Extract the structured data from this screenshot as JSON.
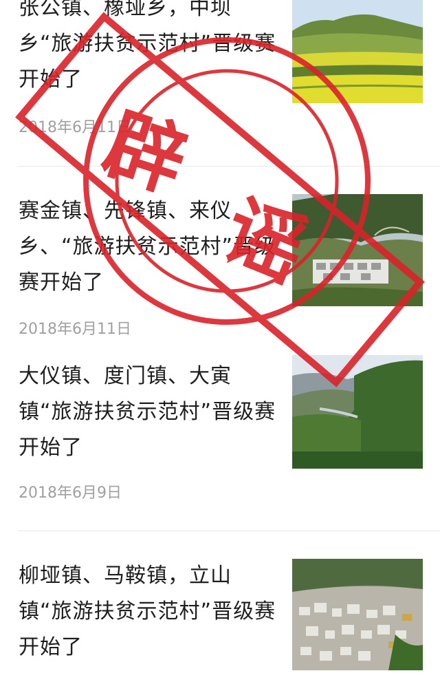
{
  "articles": [
    {
      "title": "张公镇、橡垭乡，中坝乡“旅游扶贫示范村”晋级赛开始了",
      "date": "2018年6月11日",
      "thumbnail": "rapeseed-field-photo"
    },
    {
      "title": "赛金镇、先锋镇、来仪乡、“旅游扶贫示范村”晋级赛开始了",
      "date": "2018年6月11日",
      "thumbnail": "mountain-village-photo"
    },
    {
      "title": "大仪镇、度门镇、大寅镇“旅游扶贫示范村”晋级赛开始了",
      "date": "2018年6月9日",
      "thumbnail": "green-valley-photo"
    },
    {
      "title": "柳垭镇、马鞍镇，立山镇“旅游扶贫示范村”晋级赛开始了",
      "date": "",
      "thumbnail": "town-aerial-photo"
    }
  ],
  "stamp": {
    "text_char1": "辟",
    "text_char2": "谣",
    "color": "#d9232a"
  },
  "colors": {
    "title": "#1e1e1e",
    "date": "#a0a0a0",
    "divider": "#e8e8e8"
  }
}
